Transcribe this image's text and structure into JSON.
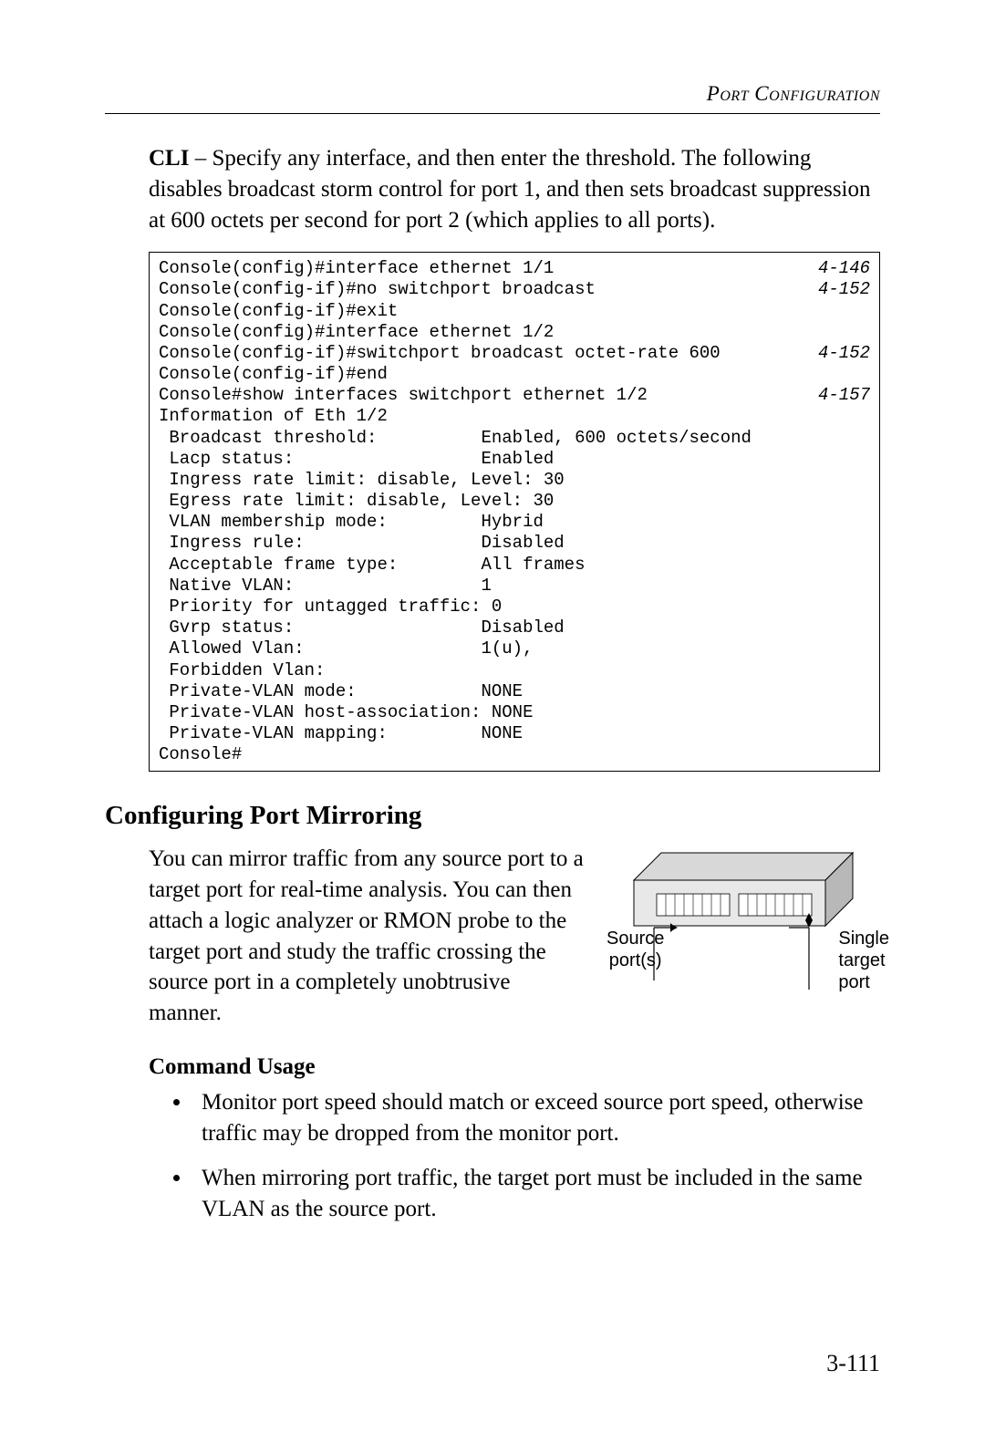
{
  "running_head": "Port Configuration",
  "intro_html": "<b>CLI</b> – Specify any interface, and then enter the threshold. The following disables broadcast storm control for port 1, and then sets broadcast suppression at 600 octets per second for port 2 (which applies to all ports).",
  "cli": [
    {
      "left": "Console(config)#interface ethernet 1/1",
      "right": "4-146"
    },
    {
      "left": "Console(config-if)#no switchport broadcast",
      "right": "4-152"
    },
    {
      "left": "Console(config-if)#exit",
      "right": ""
    },
    {
      "left": "Console(config)#interface ethernet 1/2",
      "right": ""
    },
    {
      "left": "Console(config-if)#switchport broadcast octet-rate 600",
      "right": "4-152"
    },
    {
      "left": "Console(config-if)#end",
      "right": ""
    },
    {
      "left": "Console#show interfaces switchport ethernet 1/2",
      "right": "4-157"
    },
    {
      "left": "Information of Eth 1/2",
      "right": ""
    },
    {
      "left": " Broadcast threshold:          Enabled, 600 octets/second",
      "right": ""
    },
    {
      "left": " Lacp status:                  Enabled",
      "right": ""
    },
    {
      "left": " Ingress rate limit: disable, Level: 30",
      "right": ""
    },
    {
      "left": " Egress rate limit: disable, Level: 30",
      "right": ""
    },
    {
      "left": " VLAN membership mode:         Hybrid",
      "right": ""
    },
    {
      "left": " Ingress rule:                 Disabled",
      "right": ""
    },
    {
      "left": " Acceptable frame type:        All frames",
      "right": ""
    },
    {
      "left": " Native VLAN:                  1",
      "right": ""
    },
    {
      "left": " Priority for untagged traffic: 0",
      "right": ""
    },
    {
      "left": " Gvrp status:                  Disabled",
      "right": ""
    },
    {
      "left": " Allowed Vlan:                 1(u),",
      "right": ""
    },
    {
      "left": " Forbidden Vlan:               ",
      "right": ""
    },
    {
      "left": " Private-VLAN mode:            NONE",
      "right": ""
    },
    {
      "left": " Private-VLAN host-association: NONE",
      "right": ""
    },
    {
      "left": " Private-VLAN mapping:         NONE",
      "right": ""
    },
    {
      "left": "Console#",
      "right": ""
    }
  ],
  "section_heading": "Configuring Port Mirroring",
  "mirror_paragraph": "You can mirror traffic from any source port to a target port for real-time analysis. You can then attach a logic analyzer or RMON probe to the target port and study the traffic crossing the source port in a completely unobtrusive manner.",
  "figure": {
    "label_left_1": "Source",
    "label_left_2": "port(s)",
    "label_right_1": "Single",
    "label_right_2": "target",
    "label_right_3": "port"
  },
  "subsection_heading": "Command Usage",
  "usage_items": [
    "Monitor port speed should match or exceed source port speed, otherwise traffic may be dropped from the monitor port.",
    "When mirroring port traffic, the target port must be included in the same VLAN as the source port."
  ],
  "page_number": "3-111"
}
